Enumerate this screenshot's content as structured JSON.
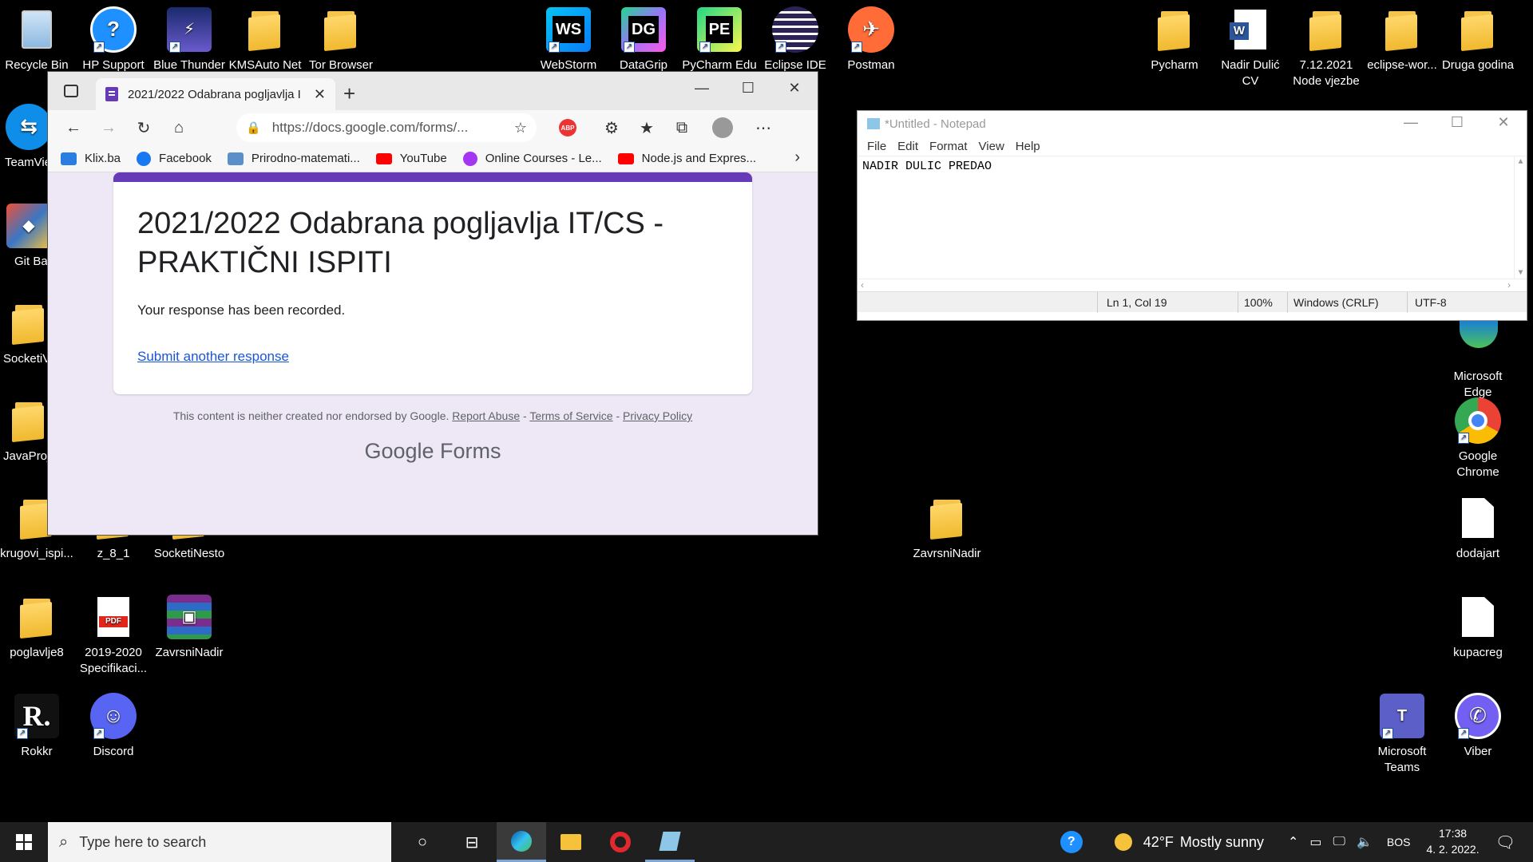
{
  "desktop_icons": [
    {
      "id": "recycle-bin",
      "label": "Recycle Bin"
    },
    {
      "id": "hp-support",
      "label": "HP Support"
    },
    {
      "id": "blue-thunder",
      "label": "Blue Thunder"
    },
    {
      "id": "kmsauto",
      "label": "KMSAuto Net"
    },
    {
      "id": "tor-browser",
      "label": "Tor Browser"
    },
    {
      "id": "webstorm",
      "label": "WebStorm"
    },
    {
      "id": "datagrip",
      "label": "DataGrip"
    },
    {
      "id": "pycharm-edu",
      "label": "PyCharm Edu"
    },
    {
      "id": "eclipse-ide",
      "label": "Eclipse IDE"
    },
    {
      "id": "postman",
      "label": "Postman"
    },
    {
      "id": "pycharm-folder",
      "label": "Pycharm"
    },
    {
      "id": "nadir-cv",
      "label": "Nadir Dulić CV"
    },
    {
      "id": "node-vjezbe",
      "label": "7.12.2021 Node vjezbe"
    },
    {
      "id": "eclipse-wor",
      "label": "eclipse-wor..."
    },
    {
      "id": "druga-godina",
      "label": "Druga godina"
    },
    {
      "id": "teamviewer",
      "label": "TeamVie"
    },
    {
      "id": "git-bash",
      "label": "Git Ba"
    },
    {
      "id": "socketiv",
      "label": "SocketiV"
    },
    {
      "id": "javaproj",
      "label": "JavaProj"
    },
    {
      "id": "krugovi",
      "label": "krugovi_ispi..."
    },
    {
      "id": "z81",
      "label": "z_8_1"
    },
    {
      "id": "socketinesto",
      "label": "SocketiNesto"
    },
    {
      "id": "zavrsni-folder",
      "label": "ZavrsniNadir"
    },
    {
      "id": "microsoft-edge",
      "label": "Microsoft Edge"
    },
    {
      "id": "google-chrome",
      "label": "Google Chrome"
    },
    {
      "id": "dodajart",
      "label": "dodajart"
    },
    {
      "id": "poglavlje8",
      "label": "poglavlje8"
    },
    {
      "id": "spec-pdf",
      "label": "2019-2020 Specifikaci..."
    },
    {
      "id": "zavrsni-rar",
      "label": "ZavrsniNadir"
    },
    {
      "id": "kupacreg",
      "label": "kupacreg"
    },
    {
      "id": "rokkr",
      "label": "Rokkr"
    },
    {
      "id": "discord",
      "label": "Discord"
    },
    {
      "id": "ms-teams",
      "label": "Microsoft Teams"
    },
    {
      "id": "viber",
      "label": "Viber"
    }
  ],
  "browser": {
    "tab_title": "2021/2022 Odabrana pogljavlja I",
    "url": "https://docs.google.com/forms/...",
    "bookmarks": [
      {
        "label": "Klix.ba",
        "color": "#2a7de1"
      },
      {
        "label": "Facebook",
        "color": "#1877f2"
      },
      {
        "label": "Prirodno-matemati...",
        "color": "#5b8fc9"
      },
      {
        "label": "YouTube",
        "color": "#ff0000"
      },
      {
        "label": "Online Courses - Le...",
        "color": "#a435f0"
      },
      {
        "label": "Node.js and Expres...",
        "color": "#ff0000"
      }
    ],
    "form": {
      "title": "2021/2022 Odabrana pogljavlja IT/CS - PRAKTIČNI ISPITI",
      "message": "Your response has been recorded.",
      "link": "Submit another response",
      "footer_text": "This content is neither created nor endorsed by Google.",
      "report_abuse": "Report Abuse",
      "terms": "Terms of Service",
      "privacy": "Privacy Policy",
      "brand_google": "Google",
      "brand_forms": "Forms"
    }
  },
  "notepad": {
    "title": "*Untitled - Notepad",
    "menu": [
      "File",
      "Edit",
      "Format",
      "View",
      "Help"
    ],
    "text": "NADIR DULIC PREDAO",
    "status_pos": "Ln 1, Col 19",
    "status_zoom": "100%",
    "status_eol": "Windows (CRLF)",
    "status_enc": "UTF-8"
  },
  "taskbar": {
    "search_placeholder": "Type here to search",
    "weather_temp": "42°F",
    "weather_desc": "Mostly sunny",
    "lang": "BOS",
    "time": "17:38",
    "date": "4. 2. 2022."
  }
}
